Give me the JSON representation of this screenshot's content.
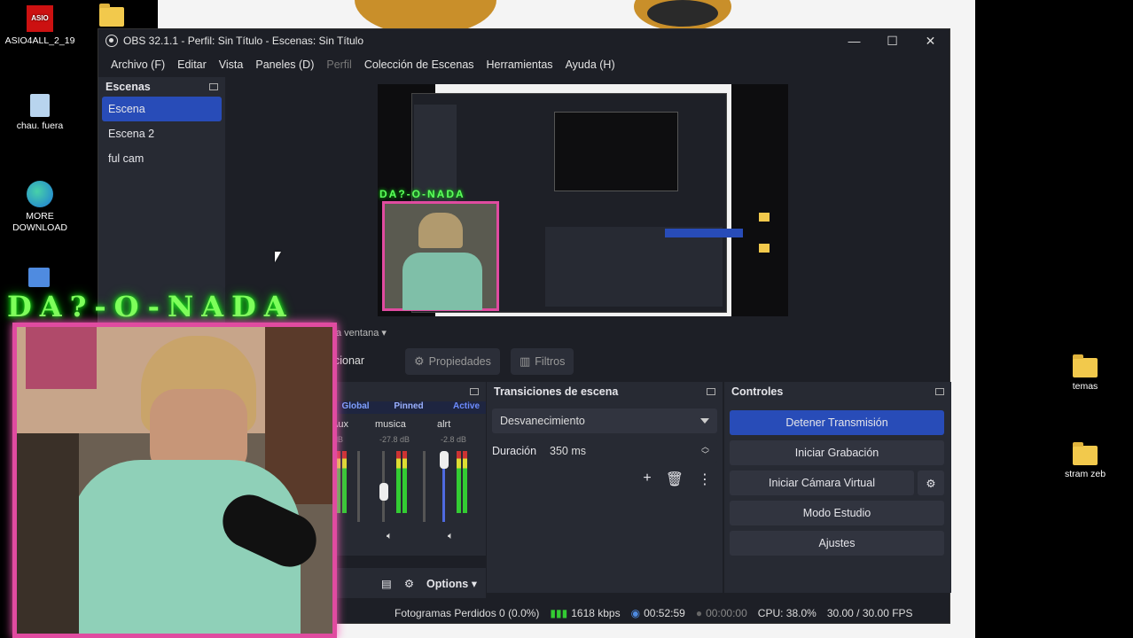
{
  "desktop": {
    "icons_left": [
      {
        "label": "ASIO4ALL_2_19",
        "icon": "asio-icon"
      },
      {
        "label": "chau. fuera",
        "icon": "recycle-bin-icon"
      },
      {
        "label": "MORE DOWNLOAD",
        "icon": "edge-icon"
      }
    ],
    "icons_right": [
      {
        "label": "temas",
        "icon": "folder-icon"
      },
      {
        "label": "stram zeb",
        "icon": "folder-icon"
      }
    ],
    "folder_top_icon": "folder-icon"
  },
  "window": {
    "title": "OBS 32.1.1 - Perfil: Sin Título - Escenas: Sin Título",
    "controls": {
      "minimize": "—",
      "maximize": "☐",
      "close": "✕"
    }
  },
  "menu": [
    "Archivo (F)",
    "Editar",
    "Vista",
    "Paneles (D)",
    "Perfil",
    "Colección de Escenas",
    "Herramientas",
    "Ayuda (H)"
  ],
  "menu_disabled": "Perfil",
  "scenes": {
    "title": "Escenas",
    "items": [
      "Escena",
      "Escena 2",
      "ful cam"
    ],
    "selected": "Escena"
  },
  "source_bar": {
    "source_label": "a ventana",
    "sources_tab": "cionar",
    "properties": "Propiedades",
    "filters": "Filtros"
  },
  "mixer": {
    "tabs": [
      "Global",
      "Pinned",
      "Active"
    ],
    "channels": [
      {
        "name": "/Aux",
        "db": "dB",
        "level": 0.45
      },
      {
        "name": "musica",
        "db": "-27.8 dB",
        "level": 0.6
      },
      {
        "name": "alrt",
        "db": "-2.8 dB",
        "level": 0.9
      }
    ],
    "options_label": "Options"
  },
  "transitions": {
    "title": "Transiciones de escena",
    "selected": "Desvanecimiento",
    "duration_label": "Duración",
    "duration_value": "350 ms"
  },
  "controls": {
    "title": "Controles",
    "stream": "Detener Transmisión",
    "record": "Iniciar Grabación",
    "virtual_cam": "Iniciar Cámara Virtual",
    "studio": "Modo Estudio",
    "settings": "Ajustes"
  },
  "status": {
    "dropped": "Fotogramas Perdidos 0 (0.0%)",
    "bitrate": "1618 kbps",
    "stream_time": "00:52:59",
    "rec_time": "00:00:00",
    "cpu": "CPU: 38.0%",
    "fps": "30.00 / 30.00 FPS"
  },
  "overlay": {
    "title": "DA?-O-NADA"
  },
  "colors": {
    "accent": "#284cb8",
    "cam_border": "#e04ba0",
    "title_glow": "#1fff1f"
  }
}
